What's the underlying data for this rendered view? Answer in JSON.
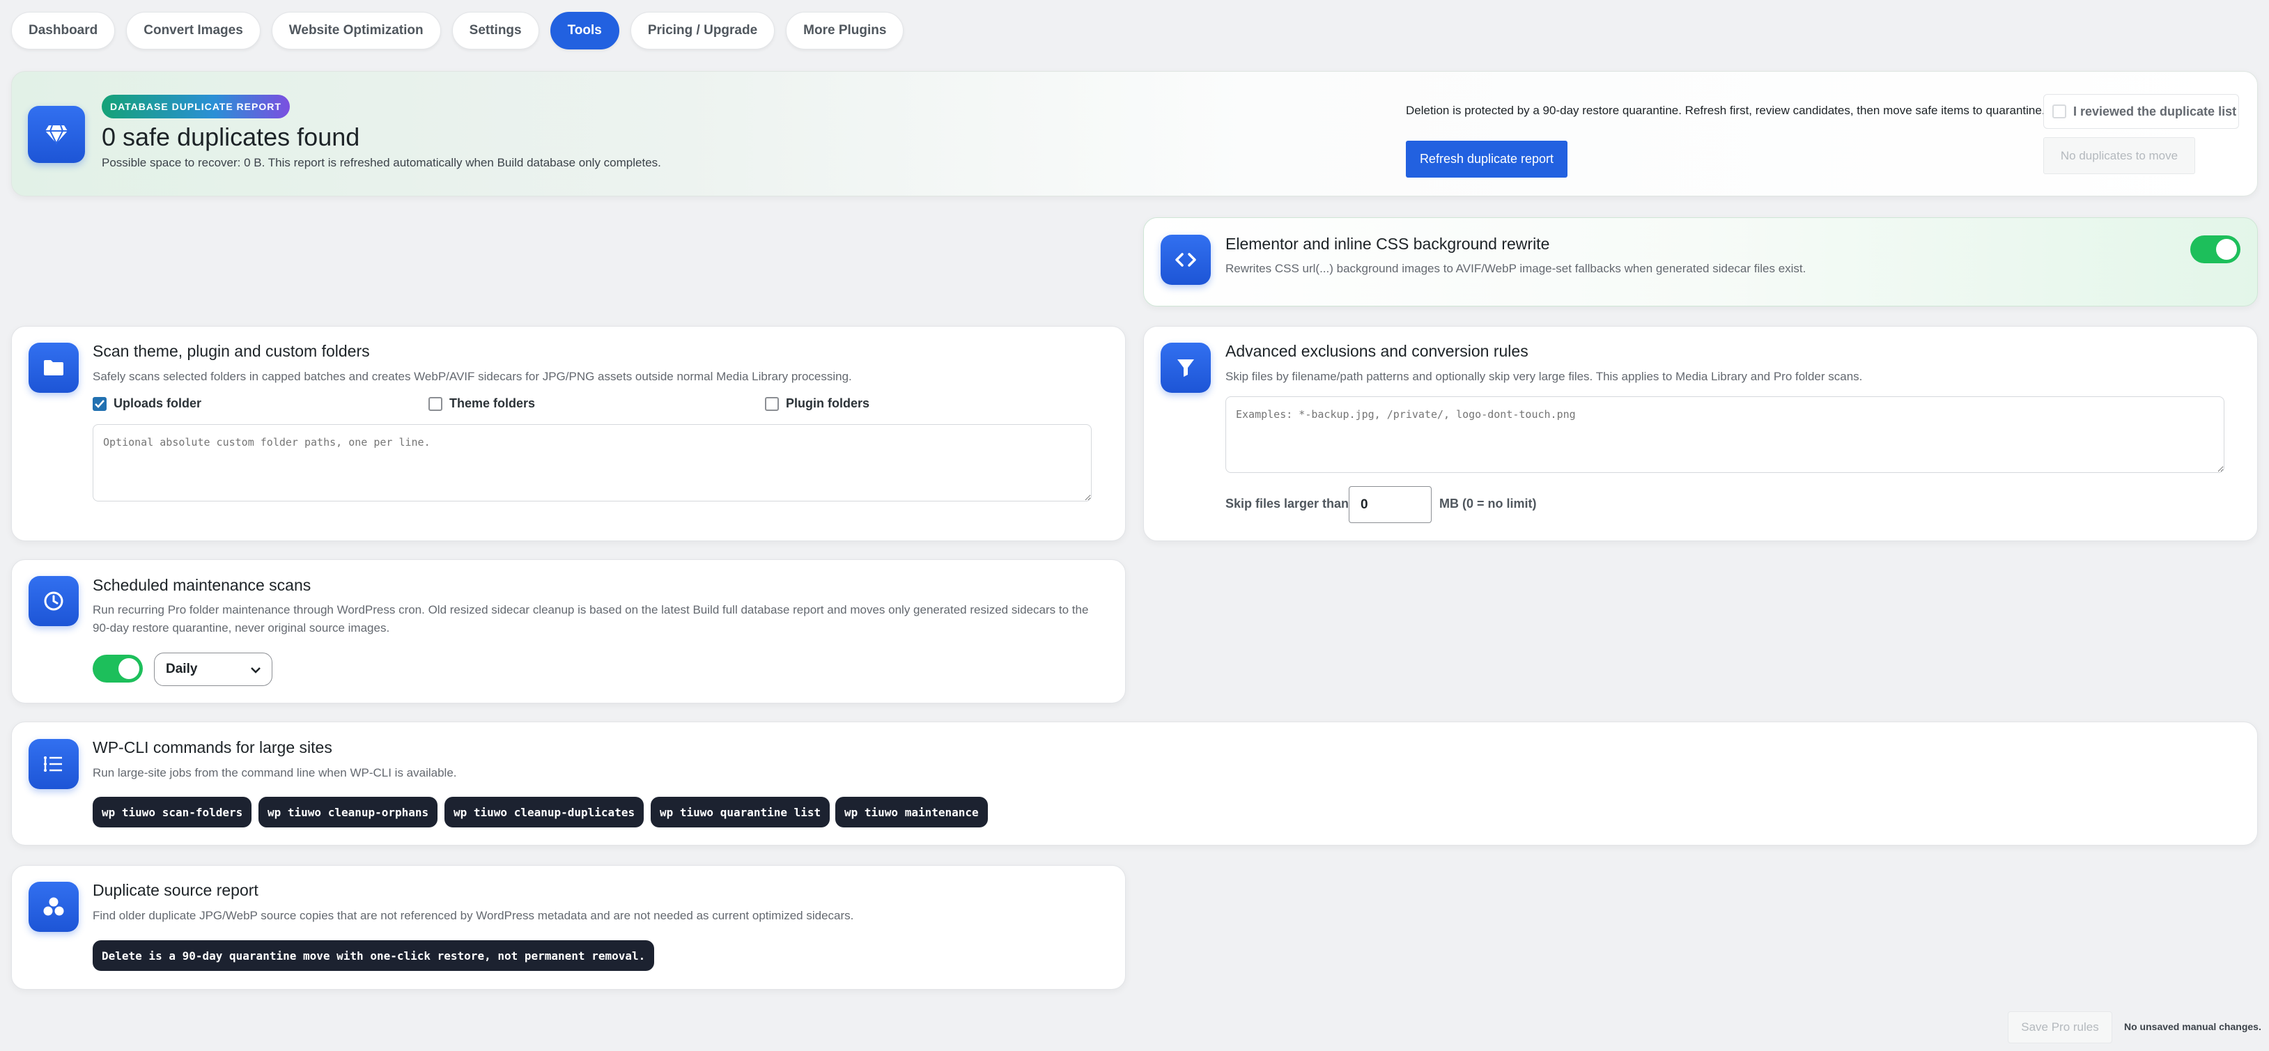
{
  "nav": {
    "tabs": [
      "Dashboard",
      "Convert Images",
      "Website Optimization",
      "Settings",
      "Tools",
      "Pricing / Upgrade",
      "More Plugins"
    ],
    "active": "Tools"
  },
  "banner": {
    "badge": "DATABASE DUPLICATE REPORT",
    "title": "0 safe duplicates found",
    "subtitle": "Possible space to recover: 0 B. This report is refreshed automatically when Build database only completes.",
    "notice": "Deletion is protected by a 90-day restore quarantine. Refresh first, review candidates, then move safe items to quarantine.",
    "review_label": "I reviewed the duplicate list",
    "refresh_button": "Refresh duplicate report",
    "move_button": "No duplicates to move"
  },
  "elementor": {
    "title": "Elementor and inline CSS background rewrite",
    "desc": "Rewrites CSS url(...) background images to AVIF/WebP image-set fallbacks when generated sidecar files exist.",
    "enabled": true
  },
  "scan_folders": {
    "title": "Scan theme, plugin and custom folders",
    "desc": "Safely scans selected folders in capped batches and creates WebP/AVIF sidecars for JPG/PNG assets outside normal Media Library processing.",
    "options": [
      {
        "label": "Uploads folder",
        "checked": true
      },
      {
        "label": "Theme folders",
        "checked": false
      },
      {
        "label": "Plugin folders",
        "checked": false
      }
    ],
    "paths_placeholder": "Optional absolute custom folder paths, one per line."
  },
  "exclusions": {
    "title": "Advanced exclusions and conversion rules",
    "desc": "Skip files by filename/path patterns and optionally skip very large files. This applies to Media Library and Pro folder scans.",
    "patterns_placeholder": "Examples: *-backup.jpg, /private/, logo-dont-touch.png",
    "skip_label": "Skip files larger than",
    "skip_value": "0",
    "skip_unit": "MB (0 = no limit)"
  },
  "scheduled": {
    "title": "Scheduled maintenance scans",
    "desc": "Run recurring Pro folder maintenance through WordPress cron. Old resized sidecar cleanup is based on the latest Build full database report and moves only generated resized sidecars to the 90-day restore quarantine, never original source images.",
    "enabled": true,
    "frequency": "Daily"
  },
  "wpcli": {
    "title": "WP-CLI commands for large sites",
    "desc": "Run large-site jobs from the command line when WP-CLI is available.",
    "commands": [
      "wp tiuwo scan-folders",
      "wp tiuwo cleanup-orphans",
      "wp tiuwo cleanup-duplicates",
      "wp tiuwo quarantine list",
      "wp tiuwo maintenance"
    ]
  },
  "duplicate_source": {
    "title": "Duplicate source report",
    "desc": "Find older duplicate JPG/WebP source copies that are not referenced by WordPress metadata and are not needed as current optimized sidecars.",
    "note": "Delete is a 90-day quarantine move with one-click restore, not permanent removal."
  },
  "footer": {
    "save_button": "Save Pro rules",
    "status": "No unsaved manual changes."
  },
  "colors": {
    "accent": "#2261e0",
    "toggle_on": "#1dbf5b",
    "code_pill": "#1c2230"
  },
  "icons": {
    "banner": "diamond-icon",
    "elementor": "code-icon",
    "scan_folders": "folder-icon",
    "exclusions": "filter-icon",
    "scheduled": "clock-icon",
    "wpcli": "list-icon",
    "duplicate_source": "circles-icon"
  }
}
